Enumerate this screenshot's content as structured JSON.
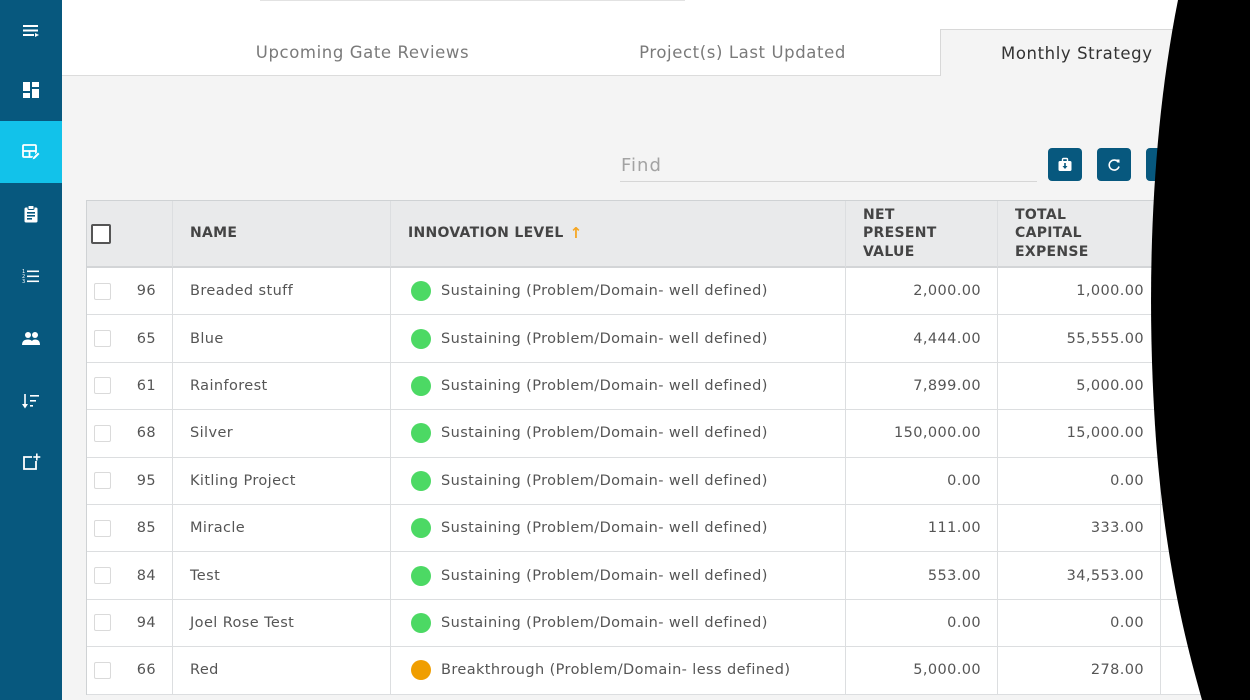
{
  "sidebar": {
    "items": [
      {
        "icon": "menu-collapse-icon",
        "active": false
      },
      {
        "icon": "dashboard-icon",
        "active": false
      },
      {
        "icon": "table-edit-icon",
        "active": true
      },
      {
        "icon": "clipboard-icon",
        "active": false
      },
      {
        "icon": "numbered-list-icon",
        "active": false
      },
      {
        "icon": "people-icon",
        "active": false
      },
      {
        "icon": "sort-icon",
        "active": false
      },
      {
        "icon": "add-box-icon",
        "active": false
      }
    ]
  },
  "tabs": [
    {
      "label": "Upcoming Gate Reviews",
      "active": false
    },
    {
      "label": "Project(s) Last Updated",
      "active": false
    },
    {
      "label": "Monthly Strategy",
      "active": true
    }
  ],
  "toolbar": {
    "find_placeholder": "Find",
    "find_value": "",
    "buttons": [
      {
        "icon": "export-briefcase-icon"
      },
      {
        "icon": "refresh-icon"
      },
      {
        "icon": "more-button-partially-hidden"
      }
    ]
  },
  "table": {
    "columns": {
      "name": "NAME",
      "innovation_level": "INNOVATION LEVEL",
      "net_present_value": "NET PRESENT VALUE",
      "total_capital_expense": "TOTAL CAPITAL EXPENSE"
    },
    "sort": {
      "column": "INNOVATION LEVEL",
      "direction": "ascending",
      "arrow": "↑"
    },
    "rows": [
      {
        "id": "96",
        "name": "Breaded stuff",
        "innovation_level": "Sustaining (Problem/Domain- well defined)",
        "level_color": "#4cd964",
        "net_present_value": "2,000.00",
        "total_capital_expense": "1,000.00"
      },
      {
        "id": "65",
        "name": "Blue",
        "innovation_level": "Sustaining (Problem/Domain- well defined)",
        "level_color": "#4cd964",
        "net_present_value": "4,444.00",
        "total_capital_expense": "55,555.00"
      },
      {
        "id": "61",
        "name": "Rainforest",
        "innovation_level": "Sustaining (Problem/Domain- well defined)",
        "level_color": "#4cd964",
        "net_present_value": "7,899.00",
        "total_capital_expense": "5,000.00"
      },
      {
        "id": "68",
        "name": "Silver",
        "innovation_level": "Sustaining (Problem/Domain- well defined)",
        "level_color": "#4cd964",
        "net_present_value": "150,000.00",
        "total_capital_expense": "15,000.00"
      },
      {
        "id": "95",
        "name": "Kitling Project",
        "innovation_level": "Sustaining (Problem/Domain- well defined)",
        "level_color": "#4cd964",
        "net_present_value": "0.00",
        "total_capital_expense": "0.00"
      },
      {
        "id": "85",
        "name": "Miracle",
        "innovation_level": "Sustaining (Problem/Domain- well defined)",
        "level_color": "#4cd964",
        "net_present_value": "111.00",
        "total_capital_expense": "333.00"
      },
      {
        "id": "84",
        "name": "Test",
        "innovation_level": "Sustaining (Problem/Domain- well defined)",
        "level_color": "#4cd964",
        "net_present_value": "553.00",
        "total_capital_expense": "34,553.00"
      },
      {
        "id": "94",
        "name": "Joel Rose Test",
        "innovation_level": "Sustaining (Problem/Domain- well defined)",
        "level_color": "#4cd964",
        "net_present_value": "0.00",
        "total_capital_expense": "0.00"
      },
      {
        "id": "66",
        "name": "Red",
        "innovation_level": "Breakthrough (Problem/Domain- less defined)",
        "level_color": "#f09e00",
        "net_present_value": "5,000.00",
        "total_capital_expense": "278.00"
      }
    ]
  },
  "colors": {
    "sidebar": "#07587e",
    "sidebar_active": "#12c2ea",
    "button": "#07587e",
    "sort_arrow": "#f5a623",
    "sustaining": "#4cd964",
    "breakthrough": "#f09e00"
  }
}
